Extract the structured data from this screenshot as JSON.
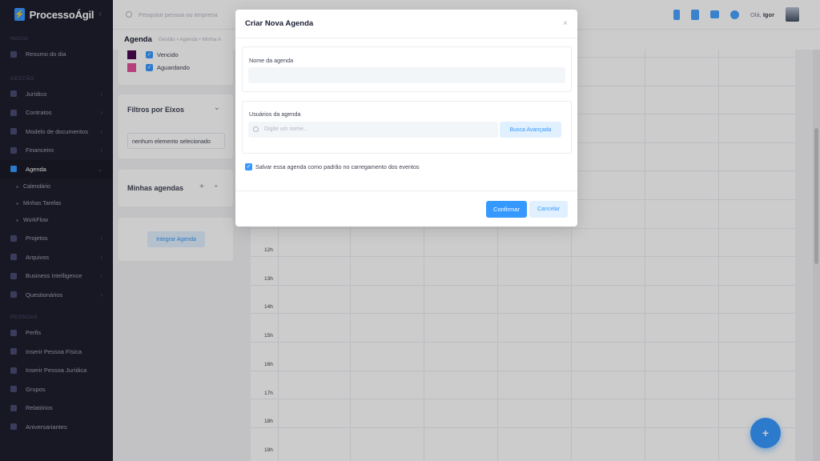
{
  "brand": {
    "name": "ProcessoÁgil",
    "toggle": "‹"
  },
  "sidebar": {
    "sections": {
      "inicio": "INICIO",
      "gestao": "GESTÃO",
      "pessoas": "PESSOAS"
    },
    "resumo": "Resumo do dia",
    "gestao_items": [
      {
        "label": "Jurídico",
        "chevron": "›"
      },
      {
        "label": "Contratos",
        "chevron": "›"
      },
      {
        "label": "Modelo de documentos",
        "chevron": "›"
      },
      {
        "label": "Financeiro",
        "chevron": "›"
      },
      {
        "label": "Agenda",
        "chevron": "⌄"
      }
    ],
    "agenda_sub": [
      "Calendário",
      "Minhas Tarefas",
      "WorkFlow"
    ],
    "gestao_items2": [
      {
        "label": "Projetos",
        "chevron": "›"
      },
      {
        "label": "Arquivos",
        "chevron": "›"
      },
      {
        "label": "Business Intelligence",
        "chevron": "›"
      },
      {
        "label": "Questionários",
        "chevron": "›"
      }
    ],
    "pessoas_items": [
      "Perfis",
      "Inserir Pessoa Física",
      "Inserir Pessoa Jurídica",
      "Grupos",
      "Relatórios",
      "Aniversariantes"
    ]
  },
  "header": {
    "search_placeholder": "Pesquise pessoa ou empresa",
    "greeting": "Olá,",
    "user": "Igor"
  },
  "subheader": {
    "title": "Agenda",
    "breadcrumb": "Gestão  •  Agenda  •  Minha A"
  },
  "legend": [
    {
      "label": "Vencido",
      "color": "#4a0b4f"
    },
    {
      "label": "Aguardando",
      "color": "#e34f9a"
    }
  ],
  "filters": {
    "title": "Filtros por Eixos",
    "chevron": "⌄",
    "value": "nenhum elemento selecionado"
  },
  "my_agendas": {
    "title": "Minhas agendas",
    "add": "+",
    "collapse": "⌃"
  },
  "integrate_button": "Integrar Agenda",
  "calendar": {
    "hours": [
      "12h",
      "13h",
      "14h",
      "15h",
      "16h",
      "17h",
      "18h",
      "19h"
    ]
  },
  "fab": "+",
  "modal": {
    "title": "Criar Nova Agenda",
    "close": "×",
    "name_label": "Nome da agenda",
    "name_value": "",
    "users_label": "Usuários da agenda",
    "users_placeholder": "Digite um nome...",
    "advanced_search": "Busca Avançada",
    "default_checkbox": "Salvar essa agenda como padrão no carregamento dos eventos",
    "default_checked": true,
    "confirm": "Confirmar",
    "cancel": "Cancelar"
  },
  "colors": {
    "primary": "#3699ff",
    "sidebar": "#1e1e2d"
  }
}
